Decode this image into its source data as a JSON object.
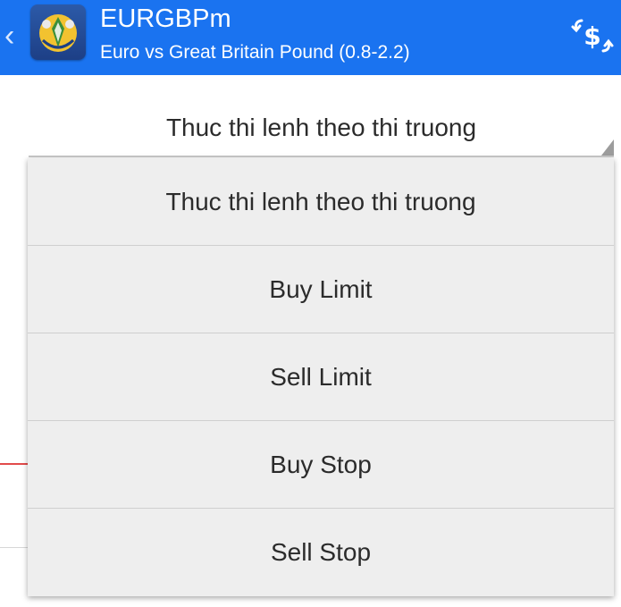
{
  "theme": {
    "accent": "#1a73f0"
  },
  "header": {
    "back_icon": "chevron-left-icon",
    "logo_icon": "metatrader-logo-icon",
    "symbol": "EURGBPm",
    "description": "Euro vs Great Britain Pound (0.8-2.2)",
    "trade_icon": "dollar-exchange-icon"
  },
  "form": {
    "execution_selected": "Thuc thi lenh theo thi truong"
  },
  "dropdown": {
    "items": [
      {
        "label": "Thuc thi lenh theo thi truong"
      },
      {
        "label": "Buy Limit"
      },
      {
        "label": "Sell Limit"
      },
      {
        "label": "Buy Stop"
      },
      {
        "label": "Sell Stop"
      }
    ]
  }
}
